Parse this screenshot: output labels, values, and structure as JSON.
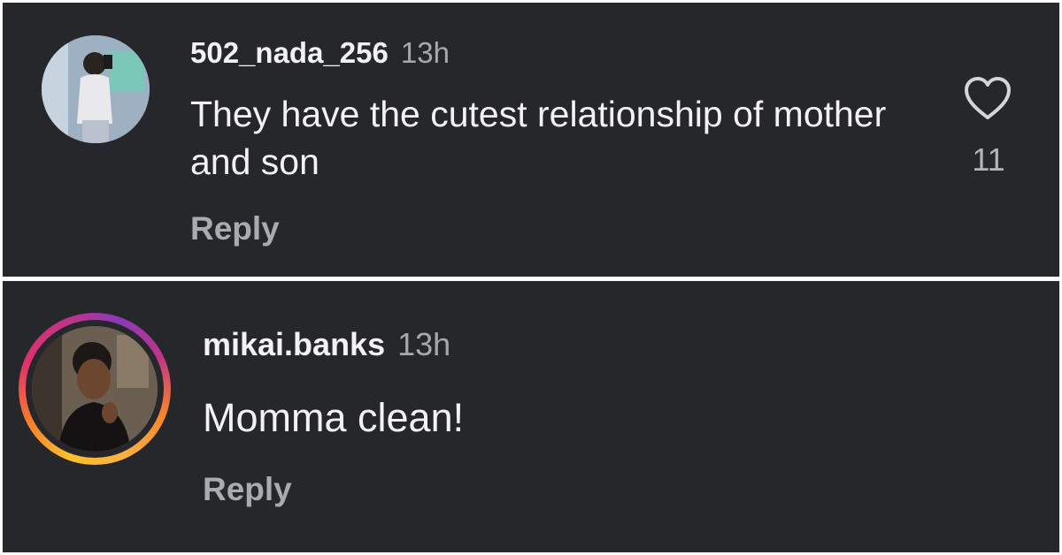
{
  "comments": [
    {
      "username": "502_nada_256",
      "time": "13h",
      "text": "They have the cutest relationship of mother and son",
      "reply_label": "Reply",
      "like_count": "11",
      "like_icon": "heart-outline-icon"
    },
    {
      "username": "mikai.banks",
      "time": "13h",
      "text": "Momma clean!",
      "reply_label": "Reply",
      "avatar_ring": "story-gradient"
    }
  ],
  "colors": {
    "background": "#26272b",
    "text_primary": "#f2f2f2",
    "text_secondary": "#a6a8ad",
    "divider": "#ffffff",
    "story_ring": [
      "#f9c02f",
      "#e1306c",
      "#8a3ab9"
    ]
  }
}
